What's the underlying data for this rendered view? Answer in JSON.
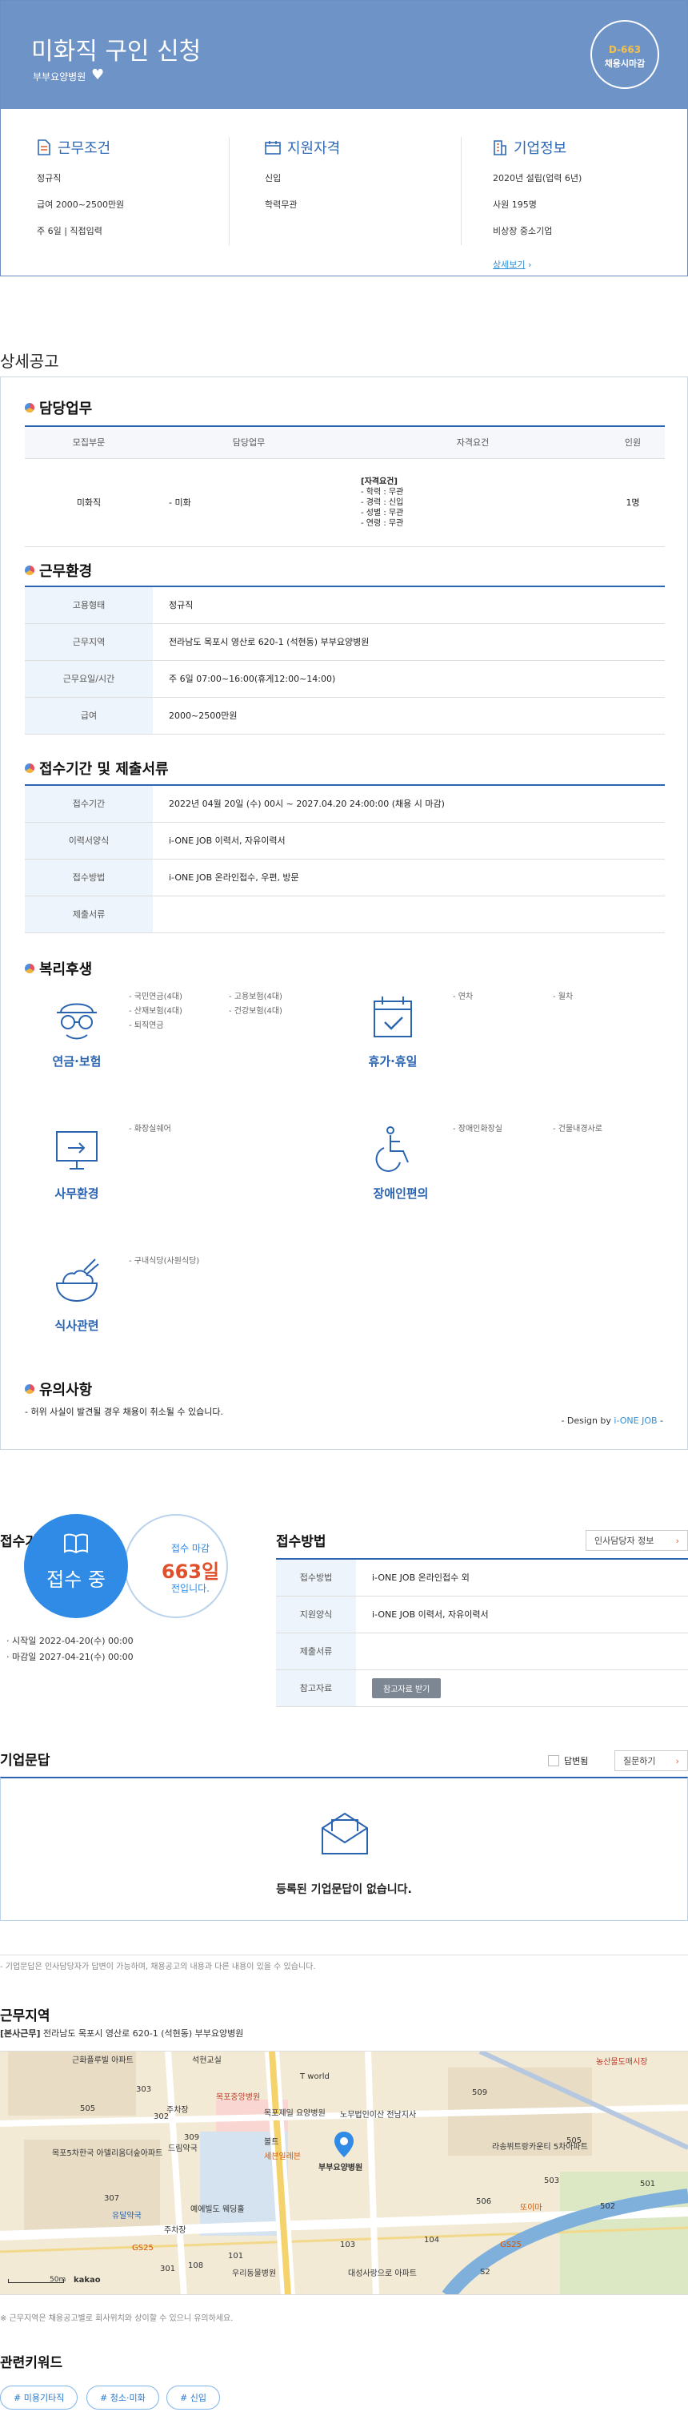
{
  "header": {
    "title": "미화직 구인 신청",
    "company": "부부요양병원",
    "dday": "D-663",
    "dday_sub": "채용시마감",
    "colors": {
      "banner": "#6e93c7",
      "accent": "#2f68b5",
      "dday_number": "#f3c04a"
    }
  },
  "info": {
    "conditions": {
      "title": "근무조건",
      "icon": "document-icon",
      "lines": [
        "정규직",
        "급여 2000~2500만원",
        "주 6일 | 직접입력"
      ]
    },
    "qualification": {
      "title": "지원자격",
      "icon": "calendar-icon",
      "lines": [
        "신입",
        "학력무관"
      ]
    },
    "company": {
      "title": "기업정보",
      "icon": "building-icon",
      "lines": [
        "2020년 설립(업력 6년)",
        "사원 195명",
        "비상장 중소기업"
      ],
      "more": "상세보기"
    }
  },
  "detail": {
    "heading": "상세공고",
    "duty": {
      "title": "담당업무",
      "headers": [
        "모집부문",
        "담당업무",
        "자격요건",
        "인원"
      ],
      "row": {
        "dept": "미화직",
        "task": "- 미화",
        "qual": [
          "[자격요건]",
          "- 학력 : 무관",
          "- 경력 : 신입",
          "- 성별 : 무관",
          "- 연령 : 무관"
        ],
        "count": "1명"
      }
    },
    "environment": {
      "title": "근무환경",
      "rows": [
        {
          "k": "고용형태",
          "v": "정규직"
        },
        {
          "k": "근무지역",
          "v": "전라남도 목포시 영산로 620-1 (석현동) 부부요양병원"
        },
        {
          "k": "근무요일/시간",
          "v": "주 6일 07:00~16:00(휴게12:00~14:00)"
        },
        {
          "k": "급여",
          "v": "2000~2500만원"
        }
      ]
    },
    "submit": {
      "title": "접수기간 및 제출서류",
      "rows": [
        {
          "k": "접수기간",
          "v": "2022년 04월 20일 (수) 00시 ~ 2027.04.20 24:00:00 (채용 시 마감)"
        },
        {
          "k": "이력서양식",
          "v": "i-ONE JOB 이력서, 자유이력서"
        },
        {
          "k": "접수방법",
          "v": "i-ONE JOB 온라인접수, 우편, 방문"
        },
        {
          "k": "제출서류",
          "v": ""
        }
      ]
    },
    "welfare": {
      "title": "복리후생",
      "items": [
        {
          "name": "연금·보험",
          "icon": "glasses-person-icon",
          "list": [
            "- 국민연금(4대)",
            "- 고용보험(4대)",
            "- 산재보험(4대)",
            "- 건강보험(4대)",
            "- 퇴직연금"
          ]
        },
        {
          "name": "휴가·휴일",
          "icon": "calendar-check-icon",
          "list": [
            "- 연차",
            "- 월차"
          ]
        },
        {
          "name": "사무환경",
          "icon": "monitor-icon",
          "list": [
            "- 화장실쉐어"
          ]
        },
        {
          "name": "장애인편의",
          "icon": "wheelchair-icon",
          "list": [
            "- 장애인화장실",
            "- 건물내경사로"
          ]
        },
        {
          "name": "식사관련",
          "icon": "rice-bowl-icon",
          "list": [
            "- 구내식당(사원식당)"
          ]
        }
      ]
    },
    "notice": {
      "title": "유의사항",
      "text": "- 허위 사실이 발견될 경우 채용이 취소될 수 있습니다."
    },
    "design_by": "- Design by ",
    "design_brand": "i-ONE JOB",
    "design_tail": " -"
  },
  "apply": {
    "period_title": "접수기간",
    "status": "접수 중",
    "deadline_label": "접수 마감",
    "deadline_days": "663일",
    "deadline_tail": "전입니다.",
    "start": "· 시작일 2022-04-20(수) 00:00",
    "end": "· 마감일 2027-04-21(수) 00:00",
    "method_title": "접수방법",
    "hr_button": "인사담당자 정보",
    "rows": [
      {
        "k": "접수방법",
        "v": "i-ONE JOB 온라인접수 외"
      },
      {
        "k": "지원양식",
        "v": "i-ONE JOB 이력서, 자유이력서"
      },
      {
        "k": "제출서류",
        "v": ""
      },
      {
        "k": "참고자료",
        "v": ""
      }
    ],
    "ref_button": "참고자료 받기"
  },
  "qa": {
    "title": "기업문답",
    "answered_label": "답변됨",
    "ask_button": "질문하기",
    "empty": "등록된 기업문답이 없습니다.",
    "footnote": "- 기업문답은 인사담당자가 답변이 가능하며, 채용공고의 내용과 다른 내용이 있을 수 있습니다."
  },
  "location": {
    "title": "근무지역",
    "address_prefix": "[본사근무]",
    "address": " 전라남도 목포시 영산로 620-1 (석현동) 부부요양병원",
    "pin_label": "부부요양병원",
    "scale": "50m",
    "brand": "kakao",
    "labels": [
      "근화플루빌 아파트",
      "석현교실",
      "T world",
      "목포중앙병원",
      "목포제일 요양병원",
      "노무법인이산 전남지사",
      "505",
      "주차장",
      "드림약국",
      "목포5차한국 아델리움더숲아파트",
      "볼트",
      "세븐일레븐",
      "라송뷔트랑카운티 5차아파트",
      "유달약국",
      "주차장",
      "예에빌도 웨딩홀",
      "우리동물병원",
      "대성사랑으로 아파트",
      "GS25",
      "GS25",
      "또이마",
      "S2",
      "농산물도매시장",
      "101",
      "103",
      "104",
      "108",
      "501",
      "502",
      "503",
      "505",
      "506",
      "509",
      "307",
      "303",
      "302",
      "309",
      "301"
    ],
    "footnote": "※ 근무지역은 채용공고별로 회사위치와 상이할 수 있으니 유의하세요."
  },
  "keywords": {
    "title": "관련키워드",
    "tags": [
      "# 미용기타직",
      "# 청소·미화",
      "# 신입"
    ]
  }
}
